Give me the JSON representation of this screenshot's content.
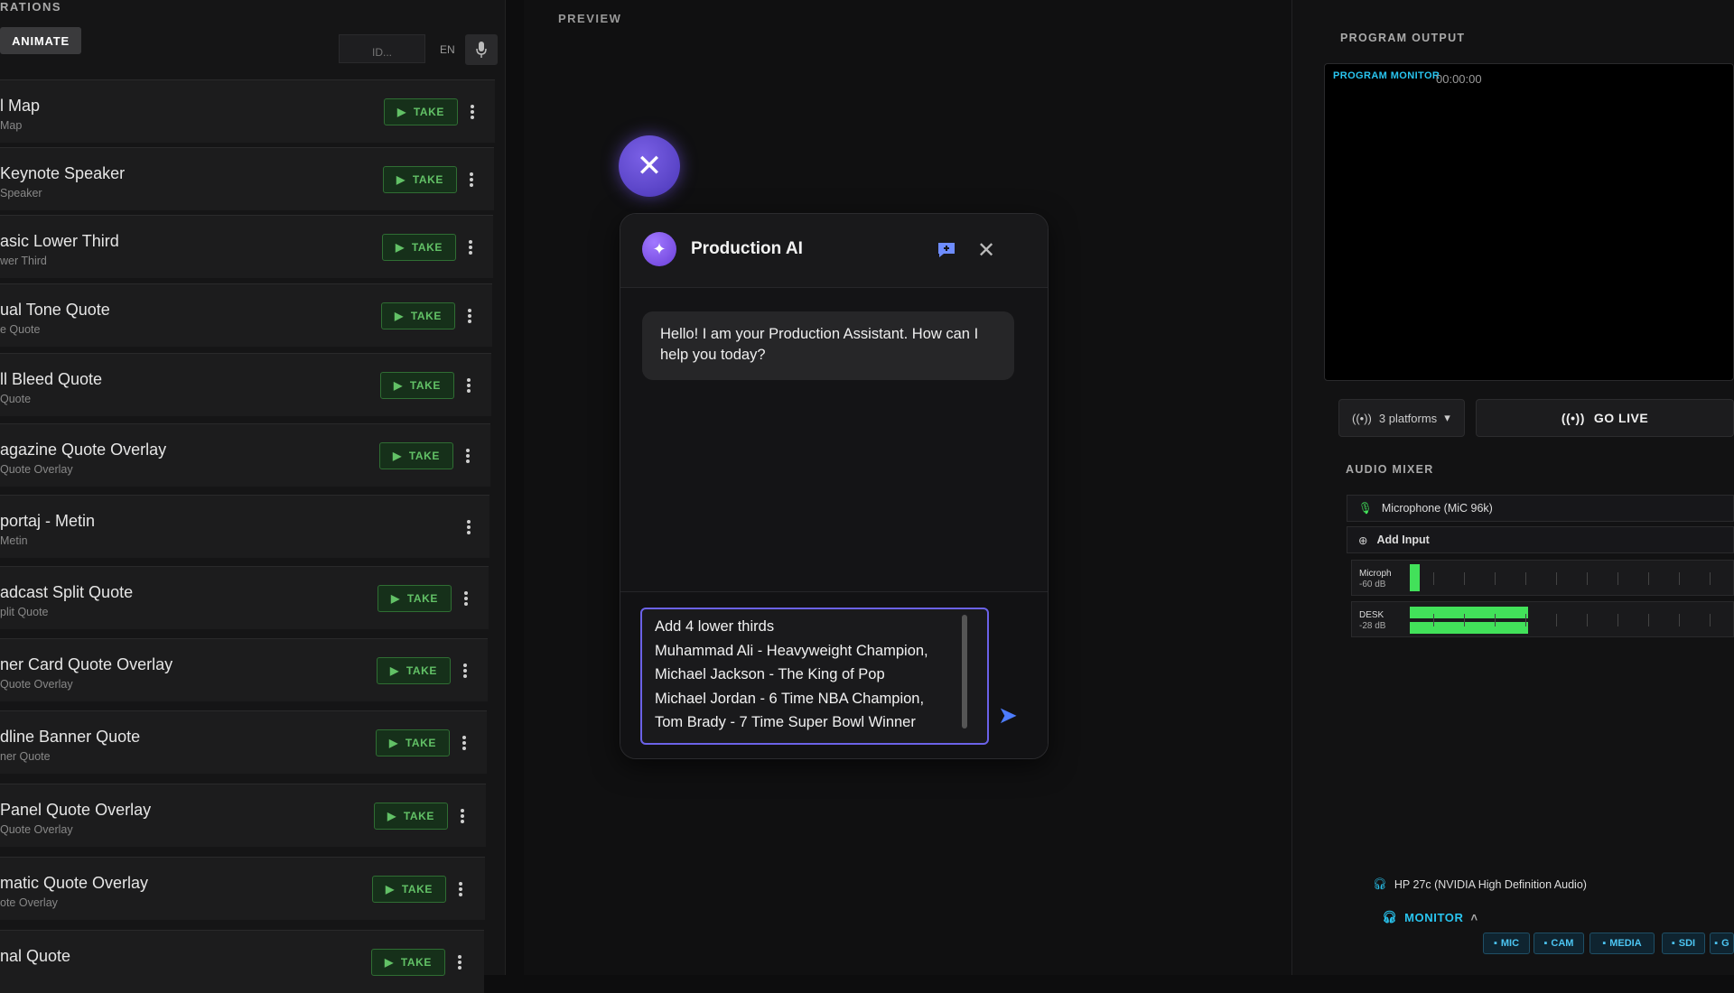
{
  "left_panel": {
    "title": "RATIONS",
    "animate_label": "ANIMATE",
    "id_placeholder": "ID...",
    "lang": "EN",
    "take_label": "TAKE",
    "items": [
      {
        "name": "l Map",
        "sub": "Map",
        "take": true
      },
      {
        "name": "Keynote Speaker",
        "sub": "Speaker",
        "take": true
      },
      {
        "name": "asic Lower Third",
        "sub": "wer Third",
        "take": true
      },
      {
        "name": "ual Tone Quote",
        "sub": "e Quote",
        "take": true
      },
      {
        "name": "ll Bleed Quote",
        "sub": "Quote",
        "take": true
      },
      {
        "name": "agazine Quote Overlay",
        "sub": "Quote Overlay",
        "take": true
      },
      {
        "name": "portaj - Metin",
        "sub": "Metin",
        "take": false
      },
      {
        "name": "adcast Split Quote",
        "sub": "plit Quote",
        "take": true
      },
      {
        "name": "ner Card Quote Overlay",
        "sub": "Quote Overlay",
        "take": true
      },
      {
        "name": "dline Banner Quote",
        "sub": "ner Quote",
        "take": true
      },
      {
        "name": "Panel Quote Overlay",
        "sub": "Quote Overlay",
        "take": true
      },
      {
        "name": "matic Quote Overlay",
        "sub": "ote Overlay",
        "take": true
      },
      {
        "name": "nal Quote",
        "sub": "",
        "take": true
      }
    ]
  },
  "preview": {
    "label": "PREVIEW"
  },
  "ai_chat": {
    "title": "Production AI",
    "greeting": "Hello! I am your Production Assistant. How can I help you today?",
    "input_value": "Add 4 lower thirds\nMuhammad Ali - Heavyweight Champion,\nMichael Jackson - The King of Pop\nMichael Jordan - 6 Time NBA Champion,\nTom Brady - 7 Time Super Bowl Winner",
    "accent": "#6b62e8"
  },
  "program": {
    "label": "PROGRAM OUTPUT",
    "monitor_tag": "PROGRAM MONITOR",
    "timecode": "00:00:00",
    "platforms": "3 platforms",
    "go_live": "GO LIVE"
  },
  "audio": {
    "label": "AUDIO MIXER",
    "mic_source": "Microphone (MiC 96k)",
    "add_input": "Add Input",
    "channels": [
      {
        "name": "Microph",
        "level_label": "-60 dB",
        "level": 0.03
      },
      {
        "name": "DESK",
        "level_label": "-28 dB",
        "level": 0.55
      }
    ],
    "device": "HP 27c (NVIDIA High Definition Audio)",
    "monitor_label": "MONITOR",
    "chips": [
      "MIC",
      "CAM",
      "MEDIA",
      "SDI",
      "G"
    ],
    "meter_color": "#42e15a"
  }
}
